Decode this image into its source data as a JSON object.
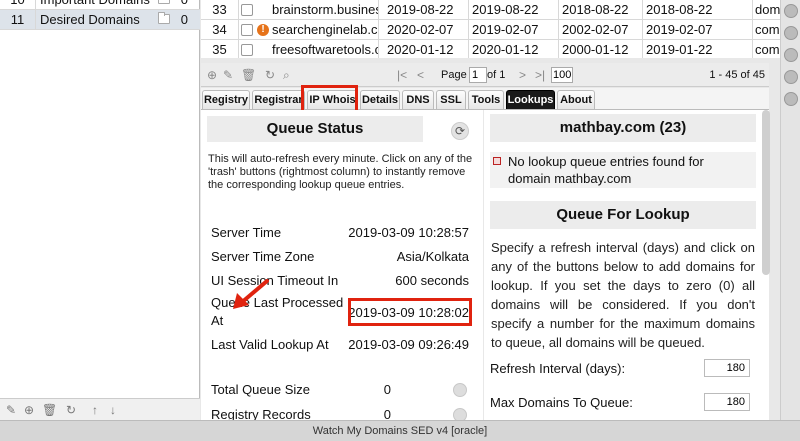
{
  "left_panel": {
    "rows": [
      {
        "num": "10",
        "name": "Important Domains",
        "count": "0"
      },
      {
        "num": "11",
        "name": "Desired Domains",
        "count": "0"
      }
    ]
  },
  "grid": {
    "rows": [
      {
        "num": "33",
        "domain": "brainstorm.business",
        "d1": "2019-08-22",
        "d2": "2019-08-22",
        "d3": "2018-08-22",
        "d4": "2018-08-22",
        "tld": "domain"
      },
      {
        "num": "34",
        "domain": "searchenginelab.com",
        "d1": "2020-02-07",
        "d2": "2019-02-07",
        "d3": "2002-02-07",
        "d4": "2019-02-07",
        "tld": "com"
      },
      {
        "num": "35",
        "domain": "freesoftwaretools.com",
        "d1": "2020-01-12",
        "d2": "2020-01-12",
        "d3": "2000-01-12",
        "d4": "2019-01-22",
        "tld": "com"
      }
    ]
  },
  "pager": {
    "page_label": "Page",
    "page": "1",
    "of": "of 1",
    "size": "100",
    "range": "1 - 45 of 45"
  },
  "tabs": [
    "Registry",
    "Registrar",
    "IP Whois",
    "Details",
    "DNS",
    "SSL",
    "Tools",
    "Lookups",
    "About"
  ],
  "queue_status": {
    "title": "Queue Status",
    "info": "This will auto-refresh every minute. Click on any of the 'trash' buttons (rightmost column) to instantly remove the corresponding lookup queue entries.",
    "server_time_label": "Server Time",
    "server_time": "2019-03-09 10:28:57",
    "tz_label": "Server Time Zone",
    "tz": "Asia/Kolkata",
    "timeout_label": "UI Session Timeout In",
    "timeout": "600 seconds",
    "last_processed_label": "Queue Last Processed At",
    "last_processed": "2019-03-09 10:28:02",
    "last_valid_label": "Last Valid Lookup At",
    "last_valid": "2019-03-09 09:26:49",
    "total_label": "Total Queue Size",
    "total": "0",
    "registry_label": "Registry Records",
    "registry": "0"
  },
  "lookup_panel": {
    "domain_title": "mathbay.com (23)",
    "no_entries": "No lookup queue entries found for domain mathbay.com",
    "queue_title": "Queue For Lookup",
    "para": "Specify a refresh interval (days) and click on any of the buttons below to add domains for lookup. If you set the days to zero (0) all domains will be considered. If you don't specify a number for the maximum domains to queue, all domains will be queued.",
    "refresh_label": "Refresh Interval (days):",
    "refresh_value": "180",
    "max_label": "Max Domains To Queue:",
    "max_value": "180"
  },
  "status_bar": "Watch My Domains SED v4 [oracle]",
  "colors": {
    "highlight": "#e0230f",
    "active_tab": "#1a1a1a"
  }
}
